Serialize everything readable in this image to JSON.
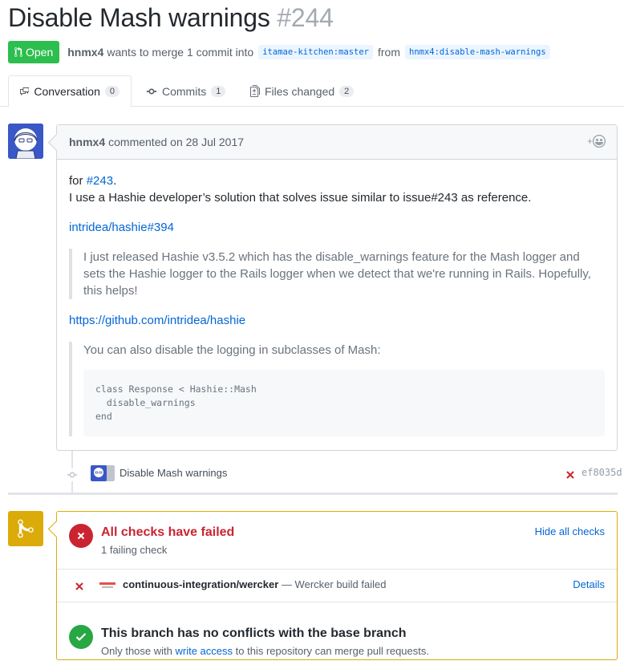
{
  "pr": {
    "title": "Disable Mash warnings",
    "number": "#244",
    "state": "Open",
    "author": "hnmx4",
    "merge_text": "wants to merge 1 commit into",
    "base_branch": "itamae-kitchen:master",
    "from_text": "from",
    "head_branch": "hnmx4:disable-mash-warnings"
  },
  "tabs": [
    {
      "label": "Conversation",
      "count": "0",
      "icon": "comment-discussion-icon"
    },
    {
      "label": "Commits",
      "count": "1",
      "icon": "git-commit-icon"
    },
    {
      "label": "Files changed",
      "count": "2",
      "icon": "file-diff-icon"
    }
  ],
  "comment": {
    "author": "hnmx4",
    "action": "commented on 28 Jul 2017",
    "reaction": "+",
    "for_prefix": "for",
    "for_link": "#243",
    "for_suffix": ".",
    "line2": "I use a Hashie developer’s solution that solves issue similar to issue#243 as reference.",
    "link1": "intridea/hashie#394",
    "quote1": "I just released Hashie v3.5.2 which has the disable_warnings feature for the Mash logger and sets the Hashie logger to the Rails logger when we detect that we're running in Rails. Hopefully, this helps!",
    "link2": "https://github.com/intridea/hashie",
    "quote2": "You can also disable the logging in subclasses of Mash:",
    "code": "class Response < Hashie::Mash\n  disable_warnings\nend"
  },
  "commit": {
    "message": "Disable Mash warnings",
    "sha": "ef8035d",
    "status_color": "#cb2431"
  },
  "merge": {
    "checks_title": "All checks have failed",
    "checks_sub": "1 failing check",
    "hide_checks": "Hide all checks",
    "check_name": "continuous-integration/wercker",
    "check_desc": "— Wercker build failed",
    "details": "Details",
    "conflict_title": "This branch has no conflicts with the base branch",
    "conflict_sub_prefix": "Only those with",
    "conflict_sub_link": "write access",
    "conflict_sub_suffix": "to this repository can merge pull requests."
  },
  "colors": {
    "open_green": "#2cbe4e",
    "fail_red": "#cb2431",
    "success_green": "#28a745",
    "warning_yellow": "#dbab09",
    "link_blue": "#0366d6"
  }
}
